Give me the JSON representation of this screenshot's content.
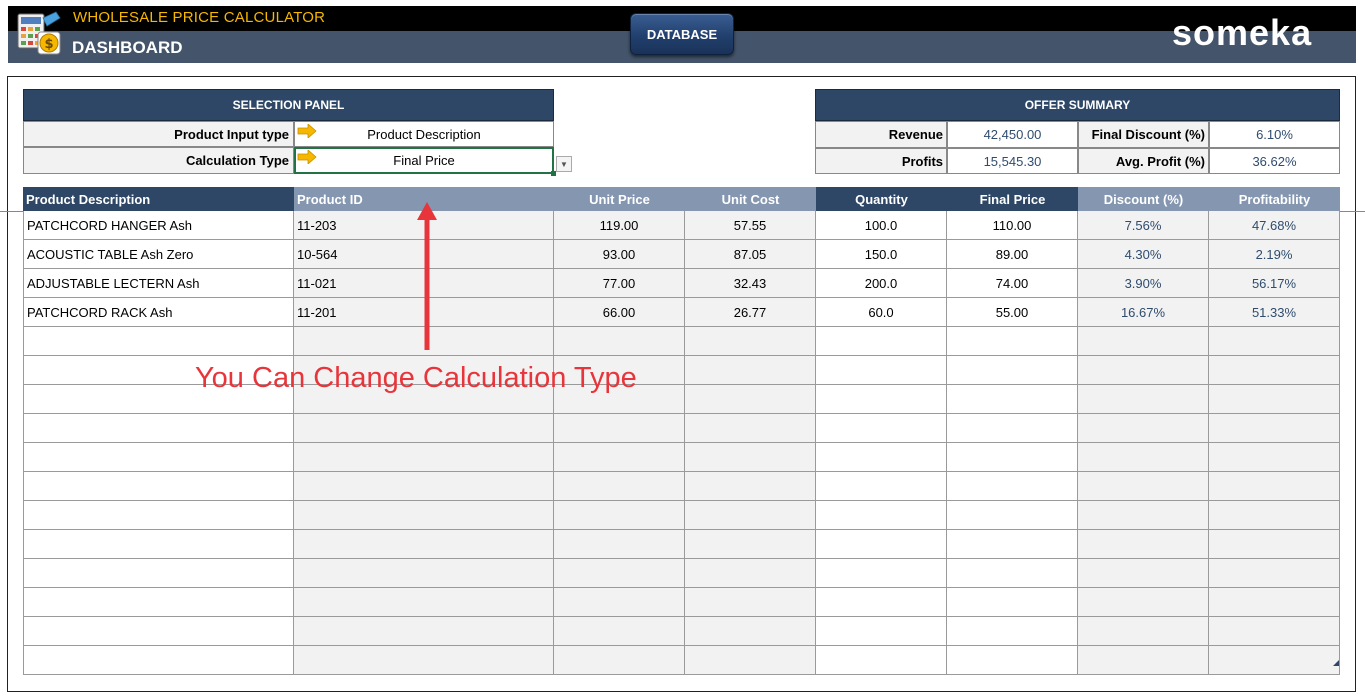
{
  "header": {
    "app_title": "WHOLESALE PRICE CALCULATOR",
    "page_title": "DASHBOARD",
    "database_button": "DATABASE",
    "logo_text": "someka"
  },
  "selection_panel": {
    "title": "SELECTION PANEL",
    "rows": [
      {
        "label": "Product Input type",
        "value": "Product Description"
      },
      {
        "label": "Calculation Type",
        "value": "Final Price"
      }
    ]
  },
  "offer_summary": {
    "title": "OFFER SUMMARY",
    "revenue_label": "Revenue",
    "revenue_value": "42,450.00",
    "profits_label": "Profits",
    "profits_value": "15,545.30",
    "final_discount_label": "Final Discount (%)",
    "final_discount_value": "6.10%",
    "avg_profit_label": "Avg. Profit (%)",
    "avg_profit_value": "36.62%"
  },
  "table": {
    "columns": [
      "Product Description",
      "Product ID",
      "Unit Price",
      "Unit Cost",
      "Quantity",
      "Final Price",
      "Discount (%)",
      "Profitability"
    ],
    "rows": [
      [
        "PATCHCORD HANGER Ash",
        "11-203",
        "119.00",
        "57.55",
        "100.0",
        "110.00",
        "7.56%",
        "47.68%"
      ],
      [
        "ACOUSTIC TABLE Ash Zero",
        "10-564",
        "93.00",
        "87.05",
        "150.0",
        "89.00",
        "4.30%",
        "2.19%"
      ],
      [
        "ADJUSTABLE LECTERN Ash",
        "11-021",
        "77.00",
        "32.43",
        "200.0",
        "74.00",
        "3.90%",
        "56.17%"
      ],
      [
        "PATCHCORD RACK Ash",
        "11-201",
        "66.00",
        "26.77",
        "60.0",
        "55.00",
        "16.67%",
        "51.33%"
      ]
    ]
  },
  "annotation": "You Can Change Calculation Type",
  "colors": {
    "header_dark": "#2e4766",
    "header_light": "#8496b0",
    "title_yellow": "#f5b700",
    "annotation_red": "#e8353b",
    "value_blue": "#2f4c6e"
  },
  "icons": {
    "app_icon": "calculator-dollar-icon",
    "row_arrow": "arrow-right-icon",
    "dropdown": "dropdown-arrow-icon",
    "annotation_arrow": "arrow-up-icon"
  }
}
